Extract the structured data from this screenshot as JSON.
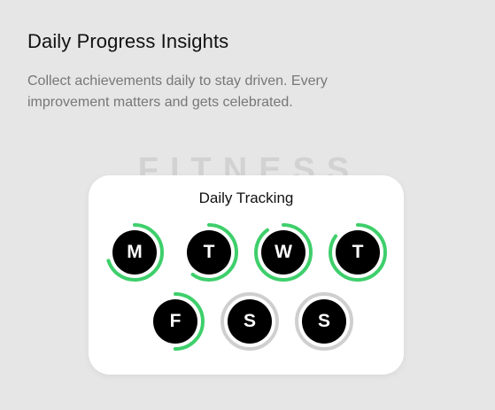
{
  "heading": "Daily Progress Insights",
  "subtext": "Collect achievements daily to stay driven. Every improvement matters and gets celebrated.",
  "watermark": "FITNESS",
  "card": {
    "title": "Daily Tracking",
    "days": [
      {
        "letter": "M",
        "progress": 0.7
      },
      {
        "letter": "T",
        "progress": 0.6
      },
      {
        "letter": "W",
        "progress": 0.9
      },
      {
        "letter": "T",
        "progress": 0.85
      },
      {
        "letter": "F",
        "progress": 0.5
      },
      {
        "letter": "S",
        "progress": 0
      },
      {
        "letter": "S",
        "progress": 0
      }
    ]
  },
  "colors": {
    "progress": "#3ecf6b",
    "track": "#cfcfcf",
    "circle": "#000000"
  }
}
